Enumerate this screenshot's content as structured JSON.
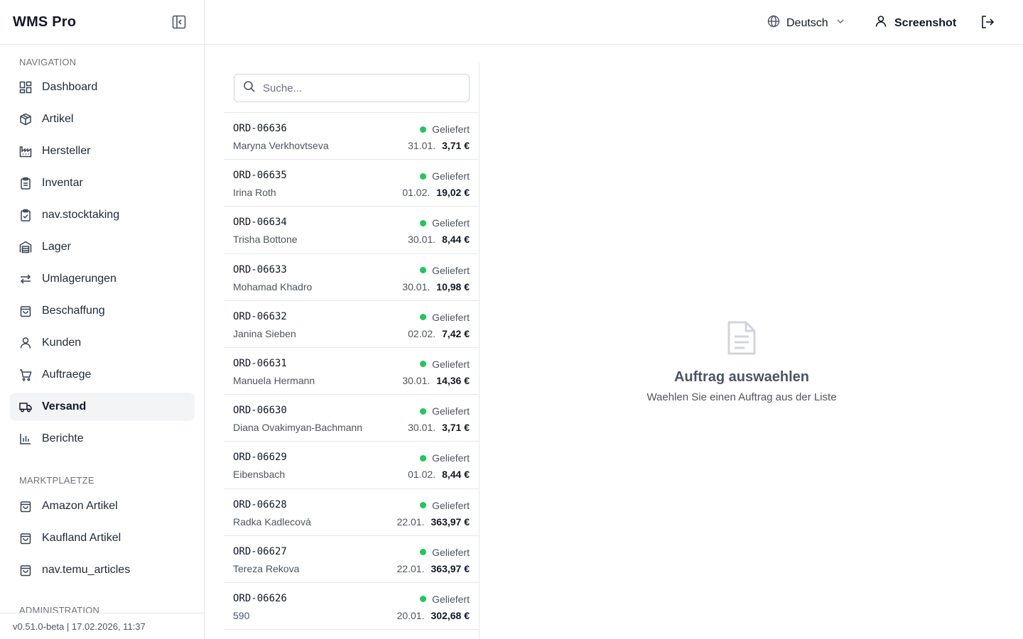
{
  "app": {
    "title": "WMS Pro",
    "version": "v0.51.0-beta | 17.02.2026, 11:37"
  },
  "sidebar": {
    "sections": [
      "NAVIGATION",
      "MARKTPLAETZE",
      "ADMINISTRATION"
    ],
    "items": [
      {
        "label": "Dashboard",
        "icon": "dashboard-icon"
      },
      {
        "label": "Artikel",
        "icon": "package-icon"
      },
      {
        "label": "Hersteller",
        "icon": "factory-icon"
      },
      {
        "label": "Inventar",
        "icon": "clipboard-icon"
      },
      {
        "label": "nav.stocktaking",
        "icon": "clipboard-check-icon"
      },
      {
        "label": "Lager",
        "icon": "warehouse-icon"
      },
      {
        "label": "Umlagerungen",
        "icon": "arrows-left-right-icon"
      },
      {
        "label": "Beschaffung",
        "icon": "shopping-bag-icon"
      },
      {
        "label": "Kunden",
        "icon": "user-icon"
      },
      {
        "label": "Auftraege",
        "icon": "cart-icon"
      },
      {
        "label": "Versand",
        "icon": "truck-icon",
        "active": true
      },
      {
        "label": "Berichte",
        "icon": "bar-chart-icon"
      }
    ],
    "marketplace_items": [
      {
        "label": "Amazon Artikel",
        "icon": "shopping-bag-icon"
      },
      {
        "label": "Kaufland Artikel",
        "icon": "shopping-bag-icon"
      },
      {
        "label": "nav.temu_articles",
        "icon": "shopping-bag-icon"
      }
    ]
  },
  "topbar": {
    "language": "Deutsch",
    "user": "Screenshot"
  },
  "search": {
    "placeholder": "Suche..."
  },
  "status_color": "#22c55e",
  "orders": [
    {
      "id": "ORD-06636",
      "status": "Geliefert",
      "customer": "Maryna Verkhovtseva",
      "date": "31.01.",
      "amount": "3,71 €"
    },
    {
      "id": "ORD-06635",
      "status": "Geliefert",
      "customer": "Irina Roth",
      "date": "01.02.",
      "amount": "19,02 €"
    },
    {
      "id": "ORD-06634",
      "status": "Geliefert",
      "customer": "Trisha Bottone",
      "date": "30.01.",
      "amount": "8,44 €"
    },
    {
      "id": "ORD-06633",
      "status": "Geliefert",
      "customer": "Mohamad Khadro",
      "date": "30.01.",
      "amount": "10,98 €"
    },
    {
      "id": "ORD-06632",
      "status": "Geliefert",
      "customer": "Janina Sieben",
      "date": "02.02.",
      "amount": "7,42 €"
    },
    {
      "id": "ORD-06631",
      "status": "Geliefert",
      "customer": "Manuela Hermann",
      "date": "30.01.",
      "amount": "14,36 €"
    },
    {
      "id": "ORD-06630",
      "status": "Geliefert",
      "customer": "Diana Ovakimyan-Bachmann",
      "date": "30.01.",
      "amount": "3,71 €"
    },
    {
      "id": "ORD-06629",
      "status": "Geliefert",
      "customer": "Eibensbach",
      "date": "01.02.",
      "amount": "8,44 €"
    },
    {
      "id": "ORD-06628",
      "status": "Geliefert",
      "customer": "Radka Kadlecová",
      "date": "22.01.",
      "amount": "363,97 €"
    },
    {
      "id": "ORD-06627",
      "status": "Geliefert",
      "customer": "Tereza Rekova",
      "date": "22.01.",
      "amount": "363,97 €"
    },
    {
      "id": "ORD-06626",
      "status": "Geliefert",
      "customer": "590",
      "date": "20.01.",
      "amount": "302,68 €"
    }
  ],
  "detail": {
    "empty_title": "Auftrag auswaehlen",
    "empty_subtitle": "Waehlen Sie einen Auftrag aus der Liste"
  }
}
